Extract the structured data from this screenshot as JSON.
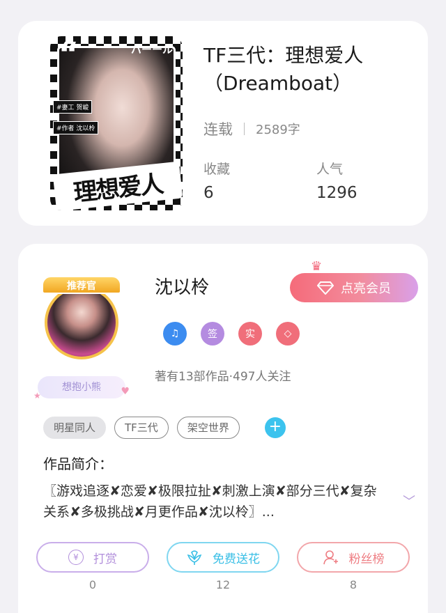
{
  "book": {
    "cover": {
      "quote_mark": "“",
      "kana": "パーール",
      "tag1": "#妻工 贺峻",
      "tag2": "#作者 沈以柃",
      "title_art": "理想爱人"
    },
    "title": "TF三代：理想爱人（Dreamboat）",
    "status": "连载",
    "word_count": "2589字",
    "stats": [
      {
        "label": "收藏",
        "value": "6"
      },
      {
        "label": "人气",
        "value": "1296"
      }
    ]
  },
  "author": {
    "recommend_badge": "推荐官",
    "nickname_badge": "想抱小熊",
    "name": "沈以柃",
    "vip_button": "点亮会员",
    "badges": [
      {
        "icon": "music-note-icon",
        "text": "♫",
        "color": "#3c8cf0"
      },
      {
        "icon": "sign-icon",
        "text": "签",
        "color": "#b48be0"
      },
      {
        "icon": "real-icon",
        "text": "实",
        "color": "#f06e7a"
      },
      {
        "icon": "diamond-icon",
        "text": "◇",
        "color": "#f06e7a"
      }
    ],
    "meta": "著有13部作品·497人关注",
    "tags": [
      "明星同人",
      "TF三代",
      "架空世界"
    ],
    "intro_label": "作品简介：",
    "intro_text": "〖游戏追逐✘恋爱✘极限拉扯✘刺激上演✘部分三代✘复杂关系✘多极挑战✘月更作品✘沈以柃〗...",
    "actions": [
      {
        "label": "打赏",
        "count": "0",
        "color": "#b28fdb",
        "icon": "yen-icon"
      },
      {
        "label": "免费送花",
        "count": "12",
        "color": "#39bfe6",
        "icon": "flower-icon"
      },
      {
        "label": "粉丝榜",
        "count": "8",
        "color": "#ee7c82",
        "icon": "fans-icon"
      }
    ]
  }
}
